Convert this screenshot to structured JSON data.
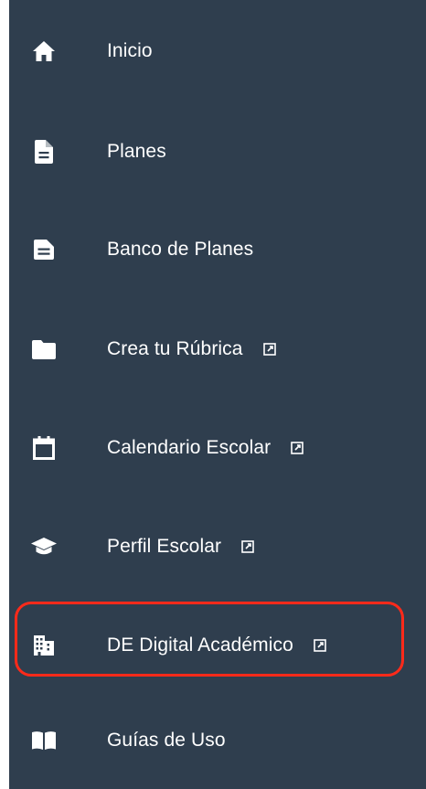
{
  "sidebar": {
    "items": [
      {
        "label": "Inicio",
        "icon": "home-icon"
      },
      {
        "label": "Planes",
        "icon": "document-icon"
      },
      {
        "label": "Banco de Planes",
        "icon": "document-alt-icon"
      },
      {
        "label": "Crea tu Rúbrica",
        "icon": "folder-icon",
        "external": true
      },
      {
        "label": "Calendario Escolar",
        "icon": "calendar-icon",
        "external": true
      },
      {
        "label": "Perfil Escolar",
        "icon": "graduation-cap-icon",
        "external": true
      },
      {
        "label": "DE Digital Académico",
        "icon": "building-icon",
        "external": true,
        "highlighted": true
      },
      {
        "label": "Guías de Uso",
        "icon": "book-icon"
      }
    ]
  },
  "colors": {
    "sidebar_background": "#2f3e4e",
    "text": "#ffffff",
    "highlight": "#ff2a1a"
  }
}
